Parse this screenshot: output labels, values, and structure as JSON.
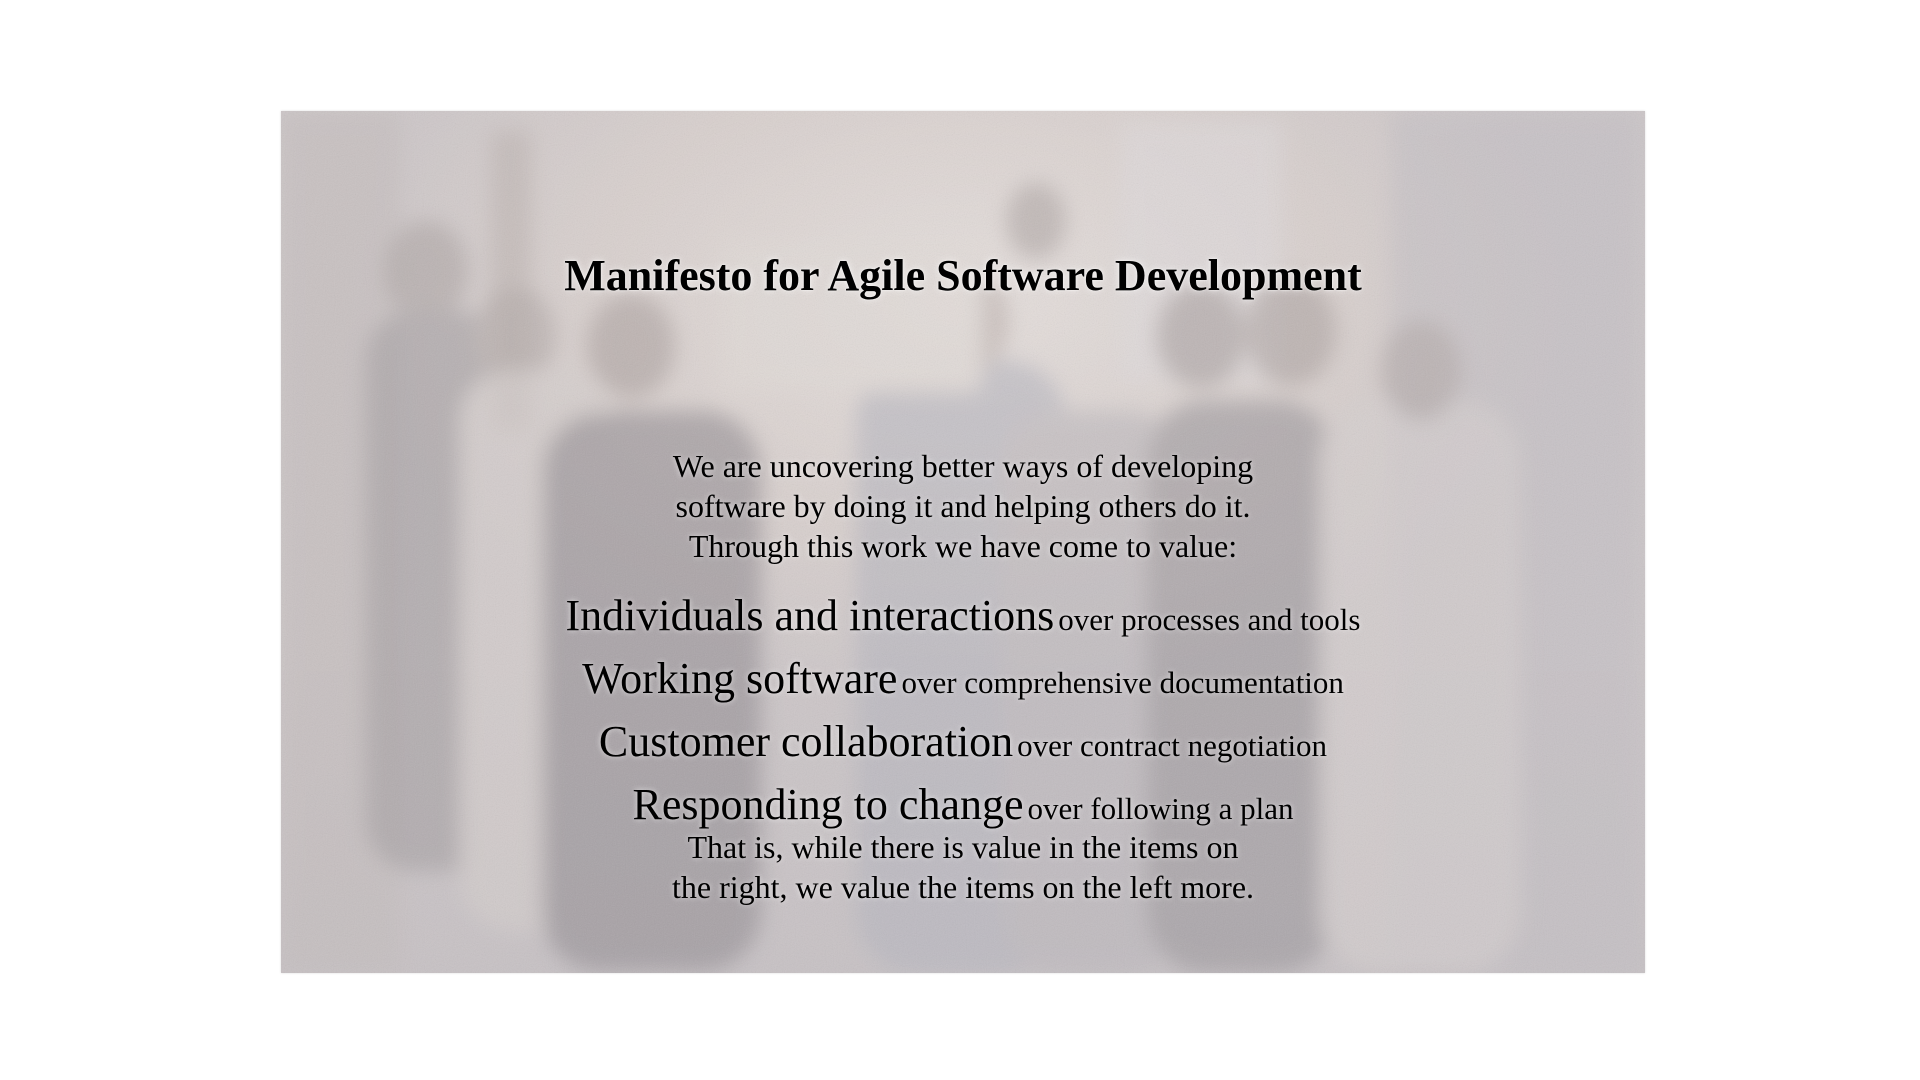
{
  "document": {
    "title": "Manifesto for Agile Software Development",
    "intro_lines": [
      "We are uncovering better ways of developing",
      "software by doing it and helping others do it.",
      "Through this work we have come to value:"
    ],
    "values": [
      {
        "left": "Individuals and interactions",
        "right": "over processes and tools"
      },
      {
        "left": "Working software",
        "right": "over comprehensive documentation"
      },
      {
        "left": "Customer collaboration",
        "right": "over contract negotiation"
      },
      {
        "left": "Responding to change",
        "right": "over following a plan"
      }
    ],
    "closing_lines": [
      "That is, while there is value in the items on",
      "the right, we value the items on the left more."
    ]
  },
  "colors": {
    "page_background": "#ffffff",
    "photo_tint": "#cdc8c6",
    "text": "#000000"
  }
}
